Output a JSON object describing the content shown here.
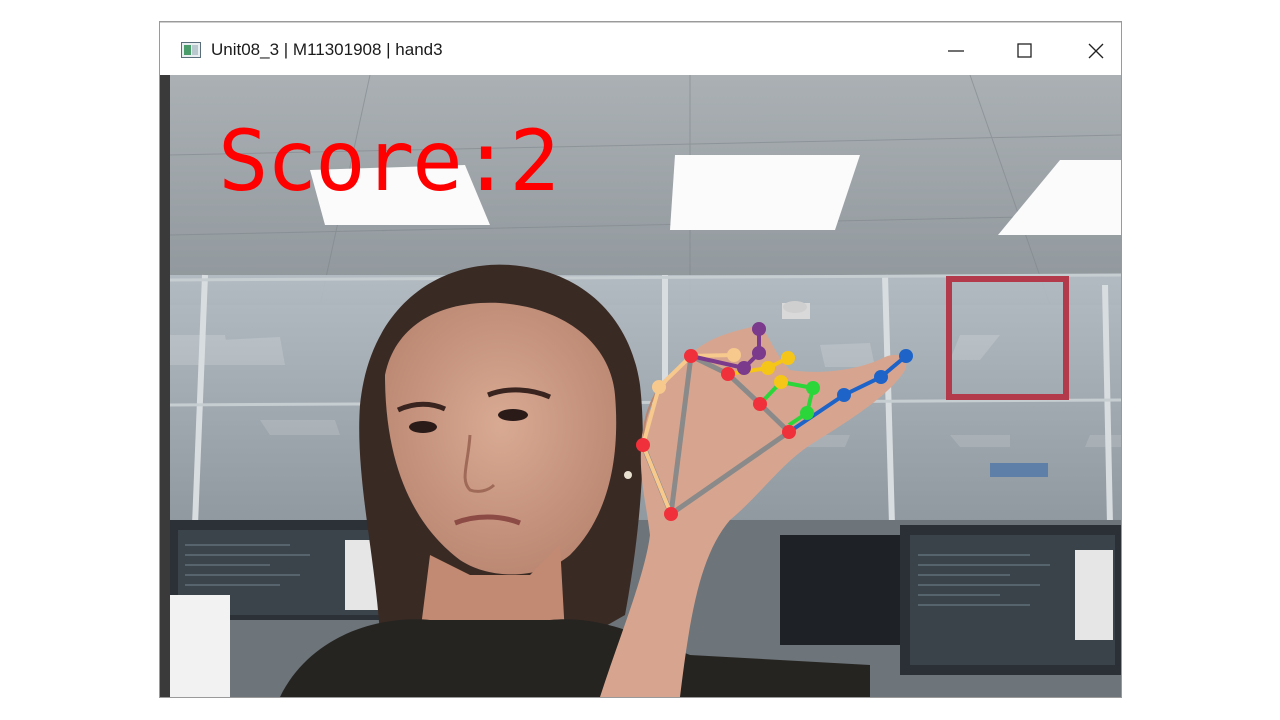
{
  "window": {
    "title": "Unit08_3 | M11301908 | hand3",
    "app_icon": "image-window-icon",
    "controls": [
      "minimize-icon",
      "maximize-icon",
      "close-icon"
    ]
  },
  "overlay": {
    "score_text": "Score:2",
    "score_color": "#ff0000",
    "target_box_color": "#b23a4b"
  },
  "hand_landmark_colors": {
    "palm": "#8a8a8a",
    "thumb": "#f7c98d",
    "index": "#7b3a8c",
    "middle": "#f5c518",
    "ring": "#2bd63a",
    "pinky": "#1e64c8",
    "joint": "#f0303a"
  }
}
